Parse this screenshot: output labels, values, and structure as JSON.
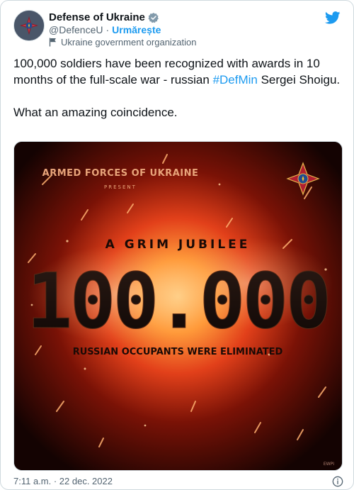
{
  "author": {
    "display_name": "Defense of Ukraine",
    "handle": "@DefenceU",
    "separator": "·",
    "follow_label": "Urmărește",
    "gov_label": "Ukraine government organization"
  },
  "tweet": {
    "line1_prefix": "100,000 soldiers have been recognized with awards in 10 months of the full-scale war - russian ",
    "hashtag": "#DefMin",
    "line1_suffix": " Sergei Shoigu.",
    "line2": "What an amazing coincidence."
  },
  "poster": {
    "org": "ARMED FORCES OF UKRAINE",
    "present": "PRESENT",
    "jubilee": "A GRIM JUBILEE",
    "number": "100.000",
    "caption": "RUSSIAN OCCUPANTS WERE ELIMINATED",
    "watermark": "EWPI"
  },
  "footer": {
    "timestamp": "7:11 a.m. · 22 dec. 2022"
  },
  "colors": {
    "accent": "#1d9bf0",
    "poster_text": "#e8a47a",
    "emblem": "#b01e2f"
  }
}
